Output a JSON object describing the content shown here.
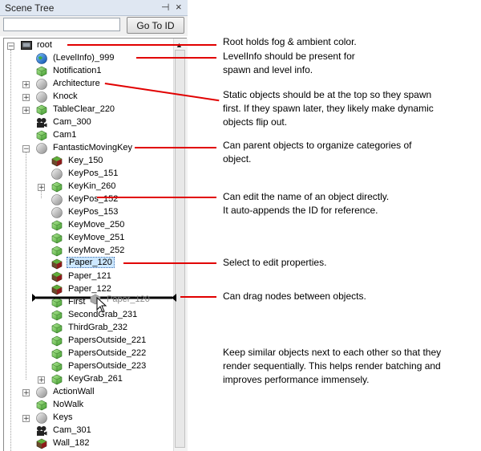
{
  "panel": {
    "title": "Scene Tree",
    "pin_glyph": "⊣",
    "close_glyph": "×",
    "search_placeholder": "",
    "goto_label": "Go To ID",
    "scroll_up_glyph": "▲"
  },
  "tree": {
    "root": "root",
    "levelinfo": "(LevelInfo)_999",
    "notification": "Notification1",
    "architecture": "Architecture",
    "knock": "Knock",
    "tableclear": "TableClear_220",
    "cam300": "Cam_300",
    "cam1": "Cam1",
    "fmk": "FantasticMovingKey",
    "key150": "Key_150",
    "keypos151": "KeyPos_151",
    "keykin260": "KeyKin_260",
    "keypos152": "KeyPos_152",
    "keypos153": "KeyPos_153",
    "keymove250": "KeyMove_250",
    "keymove251": "KeyMove_251",
    "keymove252": "KeyMove_252",
    "paper120": "Paper_120",
    "paper121": "Paper_121",
    "paper122": "Paper_122",
    "first": "First",
    "ghost": "Paper_120",
    "secondgrab": "SecondGrab_231",
    "thirdgrab": "ThirdGrab_232",
    "po221": "PapersOutside_221",
    "po222": "PapersOutside_222",
    "po223": "PapersOutside_223",
    "keygrab": "KeyGrab_261",
    "actionwall": "ActionWall",
    "nowalk": "NoWalk",
    "keys": "Keys",
    "cam301": "Cam_301",
    "wall182": "Wall_182"
  },
  "annotations": {
    "a1": "Root holds fog & ambient color.",
    "a2a": "LevelInfo should be present for",
    "a2b": "spawn and level info.",
    "a3a": "Static objects should be at the top so they spawn",
    "a3b": "first.  If they spawn later, they likely make dynamic",
    "a3c": "objects flip out.",
    "a4a": "Can parent objects to organize categories of",
    "a4b": "object.",
    "a5a": "Can edit the name of an object directly.",
    "a5b": "It auto-appends the ID for reference.",
    "a6": "Select to edit properties.",
    "a7": "Can drag nodes between objects.",
    "a8a": "Keep similar objects next to each other so that they",
    "a8b": "render sequentially.  This helps render batching and",
    "a8c": "improves performance immensely."
  },
  "colors": {
    "annotation_line": "#e10000",
    "selection": "#cde8ff"
  }
}
